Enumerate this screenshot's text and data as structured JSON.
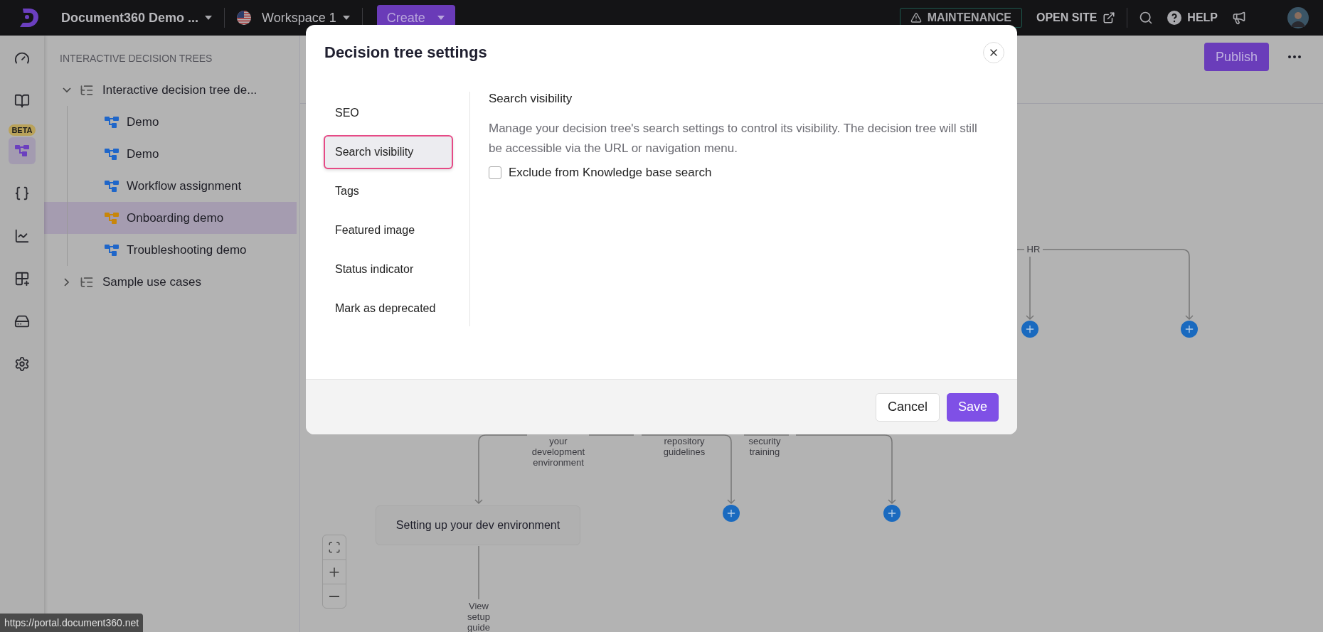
{
  "topbar": {
    "project": "Document360 Demo ...",
    "workspace": "Workspace 1",
    "create": "Create",
    "maintenance": "MAINTENANCE",
    "open_site": "OPEN SITE",
    "help": "HELP"
  },
  "rail": {
    "badge": "BETA",
    "items": [
      {
        "kind": "dashboard",
        "selected": false
      },
      {
        "kind": "docs",
        "selected": false
      },
      {
        "kind": "decision",
        "selected": true
      },
      {
        "kind": "api",
        "selected": false
      },
      {
        "kind": "analytics",
        "selected": false
      },
      {
        "kind": "apps",
        "selected": false
      },
      {
        "kind": "widget",
        "selected": false
      },
      {
        "kind": "settings",
        "selected": false
      }
    ]
  },
  "sidebar": {
    "heading": "INTERACTIVE DECISION TREES",
    "tree": [
      {
        "label": "Interactive decision tree de...",
        "expanded": true,
        "children": [
          {
            "label": "Demo",
            "selected": false
          },
          {
            "label": "Demo",
            "selected": false
          },
          {
            "label": "Workflow assignment",
            "selected": false
          },
          {
            "label": "Onboarding demo",
            "selected": true
          },
          {
            "label": "Troubleshooting demo",
            "selected": false
          }
        ]
      },
      {
        "label": "Sample use cases",
        "expanded": false
      }
    ]
  },
  "canvas": {
    "publish": "Publish",
    "edge_labels": [
      "HR",
      "your\ndevelopment\nenvironment",
      "repository\nguidelines",
      "security\ntraining",
      "View\nsetup\nguide"
    ],
    "nodes": [
      {
        "label": "Setting up your dev environment"
      }
    ]
  },
  "status_url": "https://portal.document360.net",
  "modal": {
    "title": "Decision tree settings",
    "nav": [
      {
        "label": "SEO",
        "selected": false
      },
      {
        "label": "Search visibility",
        "selected": true
      },
      {
        "label": "Tags",
        "selected": false
      },
      {
        "label": "Featured image",
        "selected": false
      },
      {
        "label": "Status indicator",
        "selected": false
      },
      {
        "label": "Mark as deprecated",
        "selected": false
      }
    ],
    "section_title": "Search visibility",
    "description": "Manage your decision tree's search settings to control its visibility. The decision tree will still be accessible via the URL or navigation menu.",
    "options": [
      {
        "label": "Exclude from Knowledge base search",
        "checked": false
      }
    ],
    "buttons": [
      {
        "label": "Cancel",
        "kind": "secondary"
      },
      {
        "label": "Save",
        "kind": "primary"
      }
    ]
  }
}
